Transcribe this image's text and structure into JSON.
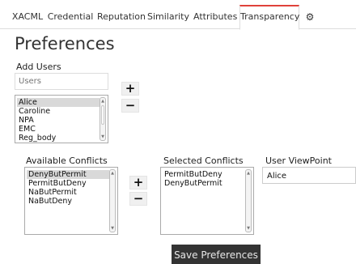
{
  "tabs": [
    {
      "label": "XACML"
    },
    {
      "label": "Credential"
    },
    {
      "label": "Reputation"
    },
    {
      "label": "Similarity"
    },
    {
      "label": "Attributes"
    },
    {
      "label": "Transparency"
    },
    {
      "icon": "gear-icon",
      "glyph": "⚙"
    }
  ],
  "active_tab": "Transparency",
  "page": {
    "title": "Preferences"
  },
  "add_users": {
    "label": "Add Users",
    "placeholder": "Users",
    "users": [
      "Alice",
      "Caroline",
      "NPA",
      "EMC",
      "Reg_body"
    ],
    "selected": "Alice",
    "add_label": "+",
    "remove_label": "−"
  },
  "available_conflicts": {
    "label": "Available Conflicts",
    "items": [
      "DenyButPermit",
      "PermitButDeny",
      "NaButPermit",
      "NaButDeny"
    ],
    "selected": "DenyButPermit"
  },
  "move_add_label": "+",
  "move_remove_label": "−",
  "selected_conflicts": {
    "label": "Selected Conflicts",
    "items": [
      "PermitButDeny",
      "DenyButPermit"
    ]
  },
  "user_viewpoint": {
    "label": "User ViewPoint",
    "value": "Alice"
  },
  "save_label": "Save Preferences"
}
